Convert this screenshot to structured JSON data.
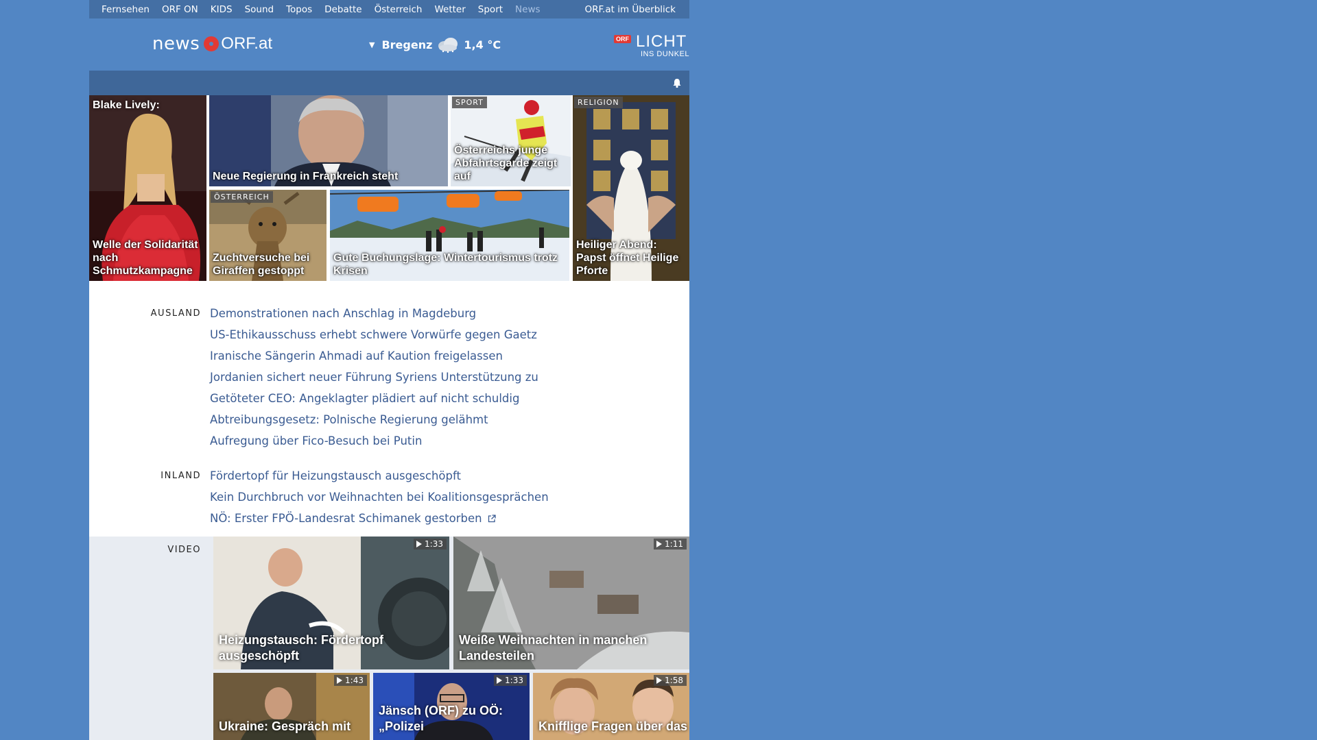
{
  "topnav": {
    "items": [
      "Fernsehen",
      "ORF ON",
      "KIDS",
      "Sound",
      "Topos",
      "Debatte",
      "Österreich",
      "Wetter",
      "Sport",
      "News"
    ],
    "active": "News",
    "overview": "ORF.at im Überblick"
  },
  "header": {
    "logo_news": "news",
    "logo_orf": "ORF.at",
    "weather_location": "Bregenz",
    "weather_temp": "1,4 °C",
    "weather_icon": "snow-cloud-icon",
    "licht_badge": "ORF",
    "licht_title": "LICHT",
    "licht_sub": "INS DUNKEL"
  },
  "teasers": {
    "blake_top": "Blake Lively:",
    "blake_title": "Welle der Solidarität nach Schmutzkampagne",
    "frankreich_title": "Neue Regierung in Frankreich steht",
    "sport_kicker": "SPORT",
    "sport_title": "Österreichs junge Abfahrtsgarde zeigt auf",
    "religion_kicker": "RELIGION",
    "religion_title": "Heiliger Abend: Papst öffnet Heilige Pforte",
    "oesterreich_kicker": "ÖSTERREICH",
    "giraffe_title": "Zuchtversuche bei Giraffen gestoppt",
    "winter_title": "Gute Buchungslage: Wintertourismus trotz Krisen"
  },
  "ausland": {
    "label": "AUSLAND",
    "items": [
      "Demonstrationen nach Anschlag in Magdeburg",
      "US-Ethikausschuss erhebt schwere Vorwürfe gegen Gaetz",
      "Iranische Sängerin Ahmadi auf Kaution freigelassen",
      "Jordanien sichert neuer Führung Syriens Unterstützung zu",
      "Getöteter CEO: Angeklagter plädiert auf nicht schuldig",
      "Abtreibungsgesetz: Polnische Regierung gelähmt",
      "Aufregung über Fico-Besuch bei Putin"
    ]
  },
  "inland": {
    "label": "INLAND",
    "items": [
      "Fördertopf für Heizungstausch ausgeschöpft",
      "Kein Durchbruch vor Weihnachten bei Koalitionsgesprächen",
      "NÖ: Erster FPÖ-Landesrat Schimanek gestorben"
    ]
  },
  "video": {
    "label": "VIDEO",
    "items": [
      {
        "duration": "1:33",
        "title": "Heizungstausch: Fördertopf ausgeschöpft"
      },
      {
        "duration": "1:11",
        "title": "Weiße Weihnachten in manchen Landesteilen"
      },
      {
        "duration": "1:43",
        "title": "Ukraine: Gespräch mit"
      },
      {
        "duration": "1:33",
        "title": "Jänsch (ORF) zu OÖ: „Polizei"
      },
      {
        "duration": "1:58",
        "title": "Knifflige Fragen über das"
      }
    ]
  },
  "colors": {
    "background": "#5286c4",
    "topnav": "#446fa4",
    "subbar": "#3f6799",
    "link": "#3a5b92",
    "orf_red": "#e23a35"
  }
}
